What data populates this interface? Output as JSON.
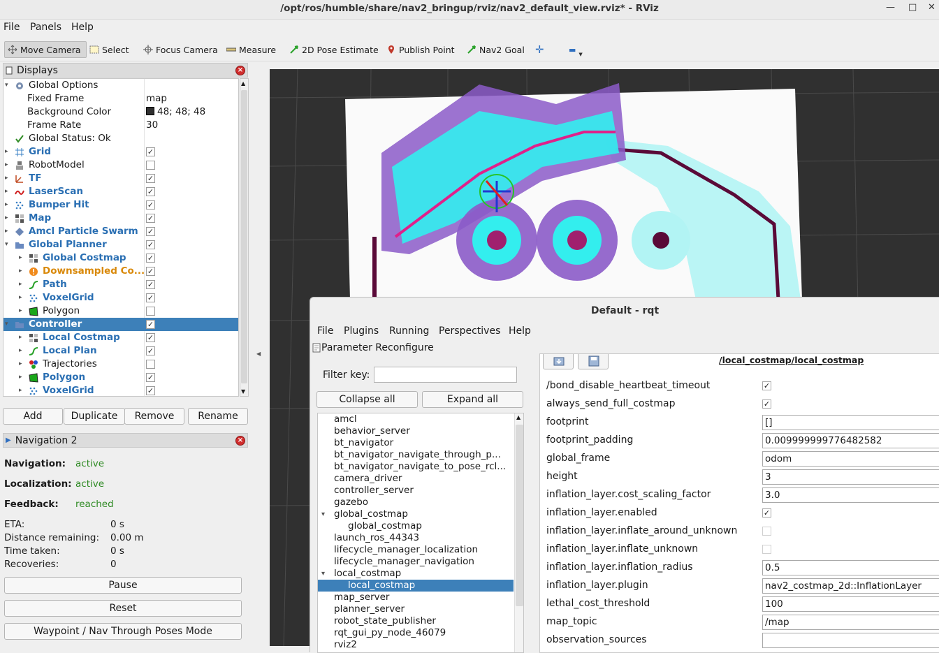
{
  "window": {
    "title": "/opt/ros/humble/share/nav2_bringup/rviz/nav2_default_view.rviz* - RViz",
    "min": "—",
    "max": "□",
    "close": "✕"
  },
  "menu": {
    "file": "File",
    "panels": "Panels",
    "help": "Help"
  },
  "toolbar": {
    "move_camera": "Move Camera",
    "select": "Select",
    "focus_camera": "Focus Camera",
    "measure": "Measure",
    "pose_estimate": "2D Pose Estimate",
    "publish_point": "Publish Point",
    "nav2_goal": "Nav2 Goal",
    "plus": "✛",
    "minus": "▬"
  },
  "displays": {
    "title": "Displays",
    "rows": [
      {
        "label": "Global Options",
        "value": "",
        "style": "plain"
      },
      {
        "label": "Fixed Frame",
        "value": "map",
        "style": "plain"
      },
      {
        "label": "Background Color",
        "value": "48; 48; 48",
        "style": "plain"
      },
      {
        "label": "Frame Rate",
        "value": "30",
        "style": "plain"
      },
      {
        "label": "Global Status: Ok",
        "value": "",
        "style": "plain"
      },
      {
        "label": "Grid",
        "checked": true,
        "style": "blue"
      },
      {
        "label": "RobotModel",
        "checked": false,
        "style": "plain"
      },
      {
        "label": "TF",
        "checked": true,
        "style": "blue"
      },
      {
        "label": "LaserScan",
        "checked": true,
        "style": "blue"
      },
      {
        "label": "Bumper Hit",
        "checked": true,
        "style": "blue"
      },
      {
        "label": "Map",
        "checked": true,
        "style": "blue"
      },
      {
        "label": "Amcl Particle Swarm",
        "checked": true,
        "style": "blue"
      },
      {
        "label": "Global Planner",
        "checked": true,
        "style": "blue"
      },
      {
        "label": "Global Costmap",
        "checked": true,
        "style": "blue"
      },
      {
        "label": "Downsampled Co...",
        "checked": true,
        "style": "orange"
      },
      {
        "label": "Path",
        "checked": true,
        "style": "blue"
      },
      {
        "label": "VoxelGrid",
        "checked": true,
        "style": "blue"
      },
      {
        "label": "Polygon",
        "checked": false,
        "style": "plain"
      },
      {
        "label": "Controller",
        "checked": true,
        "style": "selected"
      },
      {
        "label": "Local Costmap",
        "checked": true,
        "style": "blue"
      },
      {
        "label": "Local Plan",
        "checked": true,
        "style": "blue"
      },
      {
        "label": "Trajectories",
        "checked": false,
        "style": "plain"
      },
      {
        "label": "Polygon",
        "checked": true,
        "style": "blue"
      },
      {
        "label": "VoxelGrid",
        "checked": true,
        "style": "blue"
      }
    ],
    "check": "✓",
    "buttons": {
      "add": "Add",
      "duplicate": "Duplicate",
      "remove": "Remove",
      "rename": "Rename"
    }
  },
  "navigation": {
    "title": "Navigation 2",
    "navigation_label": "Navigation:",
    "navigation_value": "active",
    "localization_label": "Localization:",
    "localization_value": "active",
    "feedback_label": "Feedback:",
    "feedback_value": "reached",
    "eta_label": "ETA:",
    "eta_value": "0 s",
    "distance_label": "Distance remaining:",
    "distance_value": "0.00 m",
    "time_label": "Time taken:",
    "time_value": "0 s",
    "recoveries_label": "Recoveries:",
    "recoveries_value": "0",
    "pause": "Pause",
    "reset": "Reset",
    "waypoint": "Waypoint / Nav Through Poses Mode"
  },
  "rqt": {
    "title": "Default - rqt",
    "menu": {
      "file": "File",
      "plugins": "Plugins",
      "running": "Running",
      "perspectives": "Perspectives",
      "help": "Help"
    },
    "plugin": "Parameter Reconfigure",
    "filter_label": "Filter key:",
    "filter_value": "",
    "collapse": "Collapse all",
    "expand": "Expand all",
    "path": "/local_costmap/local_costmap",
    "nodes": [
      {
        "label": "amcl",
        "indent": 0,
        "arrow": ""
      },
      {
        "label": "behavior_server",
        "indent": 0,
        "arrow": ""
      },
      {
        "label": "bt_navigator",
        "indent": 0,
        "arrow": ""
      },
      {
        "label": "bt_navigator_navigate_through_p...",
        "indent": 0,
        "arrow": ""
      },
      {
        "label": "bt_navigator_navigate_to_pose_rcl...",
        "indent": 0,
        "arrow": ""
      },
      {
        "label": "camera_driver",
        "indent": 0,
        "arrow": ""
      },
      {
        "label": "controller_server",
        "indent": 0,
        "arrow": ""
      },
      {
        "label": "gazebo",
        "indent": 0,
        "arrow": ""
      },
      {
        "label": "global_costmap",
        "indent": 0,
        "arrow": "▾"
      },
      {
        "label": "global_costmap",
        "indent": 1,
        "arrow": ""
      },
      {
        "label": "launch_ros_44343",
        "indent": 0,
        "arrow": ""
      },
      {
        "label": "lifecycle_manager_localization",
        "indent": 0,
        "arrow": ""
      },
      {
        "label": "lifecycle_manager_navigation",
        "indent": 0,
        "arrow": ""
      },
      {
        "label": "local_costmap",
        "indent": 0,
        "arrow": "▾"
      },
      {
        "label": "local_costmap",
        "indent": 1,
        "arrow": "",
        "selected": true
      },
      {
        "label": "map_server",
        "indent": 0,
        "arrow": ""
      },
      {
        "label": "planner_server",
        "indent": 0,
        "arrow": ""
      },
      {
        "label": "robot_state_publisher",
        "indent": 0,
        "arrow": ""
      },
      {
        "label": "rqt_gui_py_node_46079",
        "indent": 0,
        "arrow": ""
      },
      {
        "label": "rviz2",
        "indent": 0,
        "arrow": ""
      }
    ],
    "params": [
      {
        "name": "/bond_disable_heartbeat_timeout",
        "type": "bool",
        "checked": true
      },
      {
        "name": "always_send_full_costmap",
        "type": "bool",
        "checked": true
      },
      {
        "name": "footprint",
        "type": "text",
        "value": "[]"
      },
      {
        "name": "footprint_padding",
        "type": "text",
        "value": "0.009999999776482582"
      },
      {
        "name": "global_frame",
        "type": "text",
        "value": "odom"
      },
      {
        "name": "height",
        "type": "text",
        "value": "3"
      },
      {
        "name": "inflation_layer.cost_scaling_factor",
        "type": "text",
        "value": "3.0"
      },
      {
        "name": "inflation_layer.enabled",
        "type": "bool",
        "checked": true
      },
      {
        "name": "inflation_layer.inflate_around_unknown",
        "type": "bool",
        "checked": false
      },
      {
        "name": "inflation_layer.inflate_unknown",
        "type": "bool",
        "checked": false
      },
      {
        "name": "inflation_layer.inflation_radius",
        "type": "text",
        "value": "0.5"
      },
      {
        "name": "inflation_layer.plugin",
        "type": "text",
        "value": "nav2_costmap_2d::InflationLayer"
      },
      {
        "name": "lethal_cost_threshold",
        "type": "text",
        "value": "100"
      },
      {
        "name": "map_topic",
        "type": "text",
        "value": "/map"
      },
      {
        "name": "observation_sources",
        "type": "text",
        "value": ""
      }
    ]
  }
}
